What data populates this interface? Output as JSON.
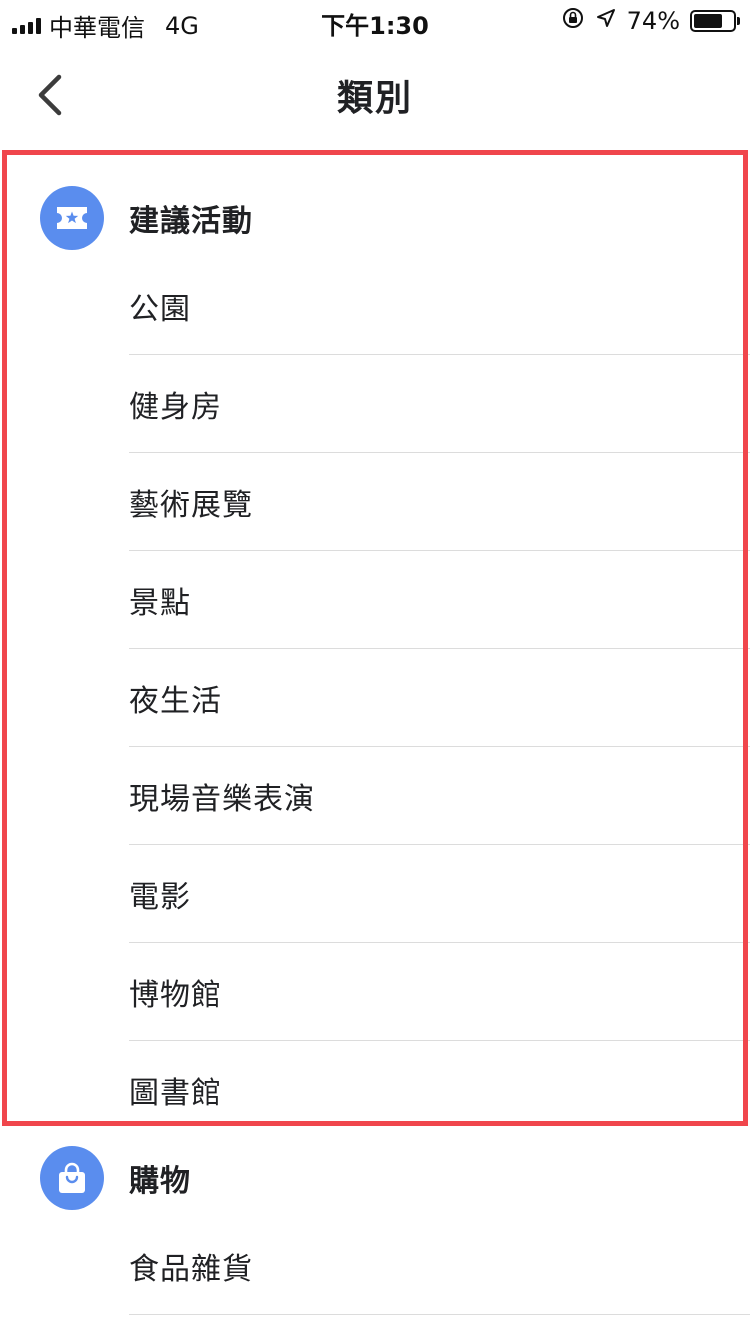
{
  "status_bar": {
    "carrier": "中華電信",
    "network": "4G",
    "time": "下午1:30",
    "battery": "74%",
    "battery_level": 0.74
  },
  "header": {
    "title": "類別",
    "back_icon": "chevron-left-icon"
  },
  "sections": [
    {
      "title": "建議活動",
      "icon": "ticket-star-icon",
      "icon_color": "#5a8dee",
      "items": [
        "公園",
        "健身房",
        "藝術展覽",
        "景點",
        "夜生活",
        "現場音樂表演",
        "電影",
        "博物館",
        "圖書館"
      ]
    },
    {
      "title": "購物",
      "icon": "shopping-bag-icon",
      "icon_color": "#5a8dee",
      "items": [
        "食品雜貨"
      ]
    }
  ],
  "highlight_color": "#f0464c"
}
